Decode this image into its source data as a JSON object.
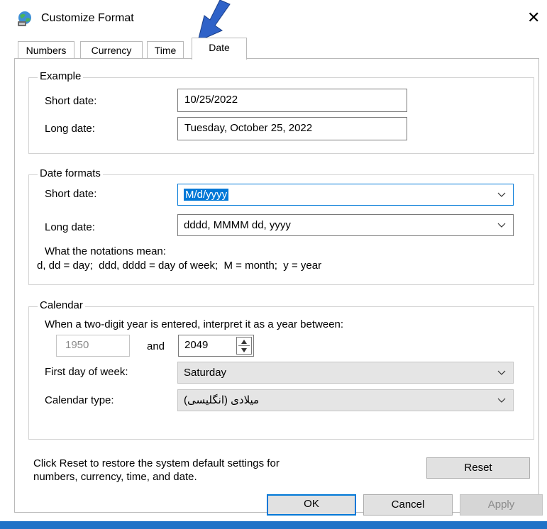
{
  "dialog": {
    "title": "Customize Format",
    "close_glyph": "✕",
    "icon": "regional-settings-icon"
  },
  "tabs": [
    {
      "label": "Numbers"
    },
    {
      "label": "Currency"
    },
    {
      "label": "Time"
    },
    {
      "label": "Date",
      "active": true
    }
  ],
  "example": {
    "legend": "Example",
    "short_label": "Short date:",
    "short_value": "10/25/2022",
    "long_label": "Long date:",
    "long_value": "Tuesday, October 25, 2022"
  },
  "formats": {
    "legend": "Date formats",
    "short_label": "Short date:",
    "short_value": "M/d/yyyy",
    "long_label": "Long date:",
    "long_value": "dddd, MMMM dd, yyyy",
    "notations_title": "What the notations mean:",
    "notations_text": "d, dd = day;  ddd, dddd = day of week;  M = month;  y = year"
  },
  "calendar": {
    "legend": "Calendar",
    "two_digit_text": "When a two-digit year is entered, interpret it as a year between:",
    "from_year": "1950",
    "and_label": "and",
    "to_year": "2049",
    "first_day_label": "First day of week:",
    "first_day_value": "Saturday",
    "type_label": "Calendar type:",
    "type_value": "میلادی (انگلیسی)"
  },
  "reset": {
    "text_line1": "Click Reset to restore the system default settings for",
    "text_line2": "numbers, currency, time, and date.",
    "button": "Reset"
  },
  "footer": {
    "ok": "OK",
    "cancel": "Cancel",
    "apply": "Apply"
  },
  "colors": {
    "accent": "#0078d7",
    "arrow": "#2f62c8",
    "taskbar": "#1f72c7"
  }
}
